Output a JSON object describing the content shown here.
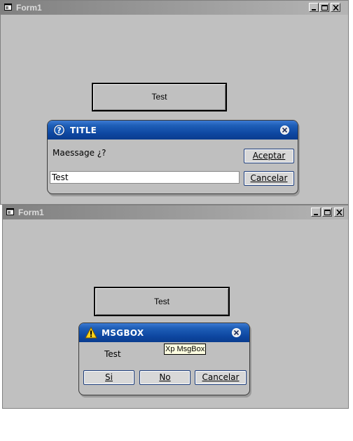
{
  "window1": {
    "title": "Form1"
  },
  "window1_button": {
    "label": "Test"
  },
  "input_dialog": {
    "title": "TITLE",
    "icon": "question-icon",
    "message": "Maessage  ¿?",
    "input_value": "Test",
    "accept_label": "Aceptar",
    "cancel_label": "Cancelar"
  },
  "window2": {
    "title": "Form1"
  },
  "window2_button": {
    "label": "Test"
  },
  "msgbox_dialog": {
    "title": "MSGBOX",
    "icon": "warning-icon",
    "message": "Test",
    "tooltip": "Xp MsgBox",
    "yes_label": "Si",
    "no_label": "No",
    "cancel_label": "Cancelar"
  },
  "colors": {
    "dialog_title_blue": "#0d46a0",
    "inactive_title_gray": "#808080",
    "form_background": "#c0c0c0"
  }
}
